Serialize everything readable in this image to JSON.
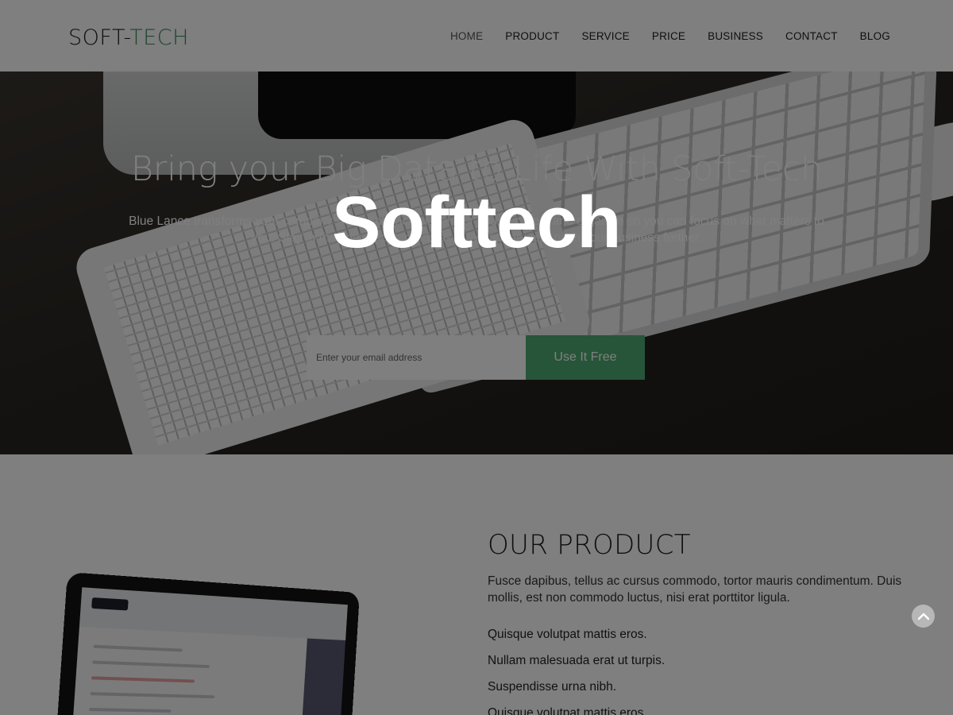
{
  "brand": {
    "logo_main": "SOFT-",
    "logo_accent": "TECH"
  },
  "nav": {
    "items": [
      {
        "label": "HOME",
        "active": true
      },
      {
        "label": "PRODUCT"
      },
      {
        "label": "SERVICE"
      },
      {
        "label": "PRICE"
      },
      {
        "label": "BUSINESS"
      },
      {
        "label": "CONTACT"
      },
      {
        "label": "BLOG"
      }
    ]
  },
  "hero": {
    "title": "Bring your Big Data to Life With Soft-Tech",
    "subtitle": "Blue Lance transforms your company's data into rich visuals for you to collect and organize so you can focus on what matters to you. Stay in the know, spot trends as they happen, and push your business further.",
    "email_placeholder": "Enter your email address",
    "cta_label": "Use It Free"
  },
  "product": {
    "title": "OUR PRODUCT",
    "description": "Fusce dapibus, tellus ac cursus commodo, tortor mauris condimentum. Duis mollis, est non commodo luctus, nisi erat porttitor ligula.",
    "features": [
      "Quisque volutpat mattis eros.",
      "Nullam malesuada erat ut turpis.",
      "Suspendisse urna nibh.",
      "Quisque volutpat mattis eros."
    ]
  },
  "overlay": {
    "watermark": "Softtech"
  },
  "colors": {
    "accent": "#4faa72",
    "logo_accent": "#3d8b5a"
  },
  "icons": {
    "scroll_top": "chevron-up-icon"
  }
}
